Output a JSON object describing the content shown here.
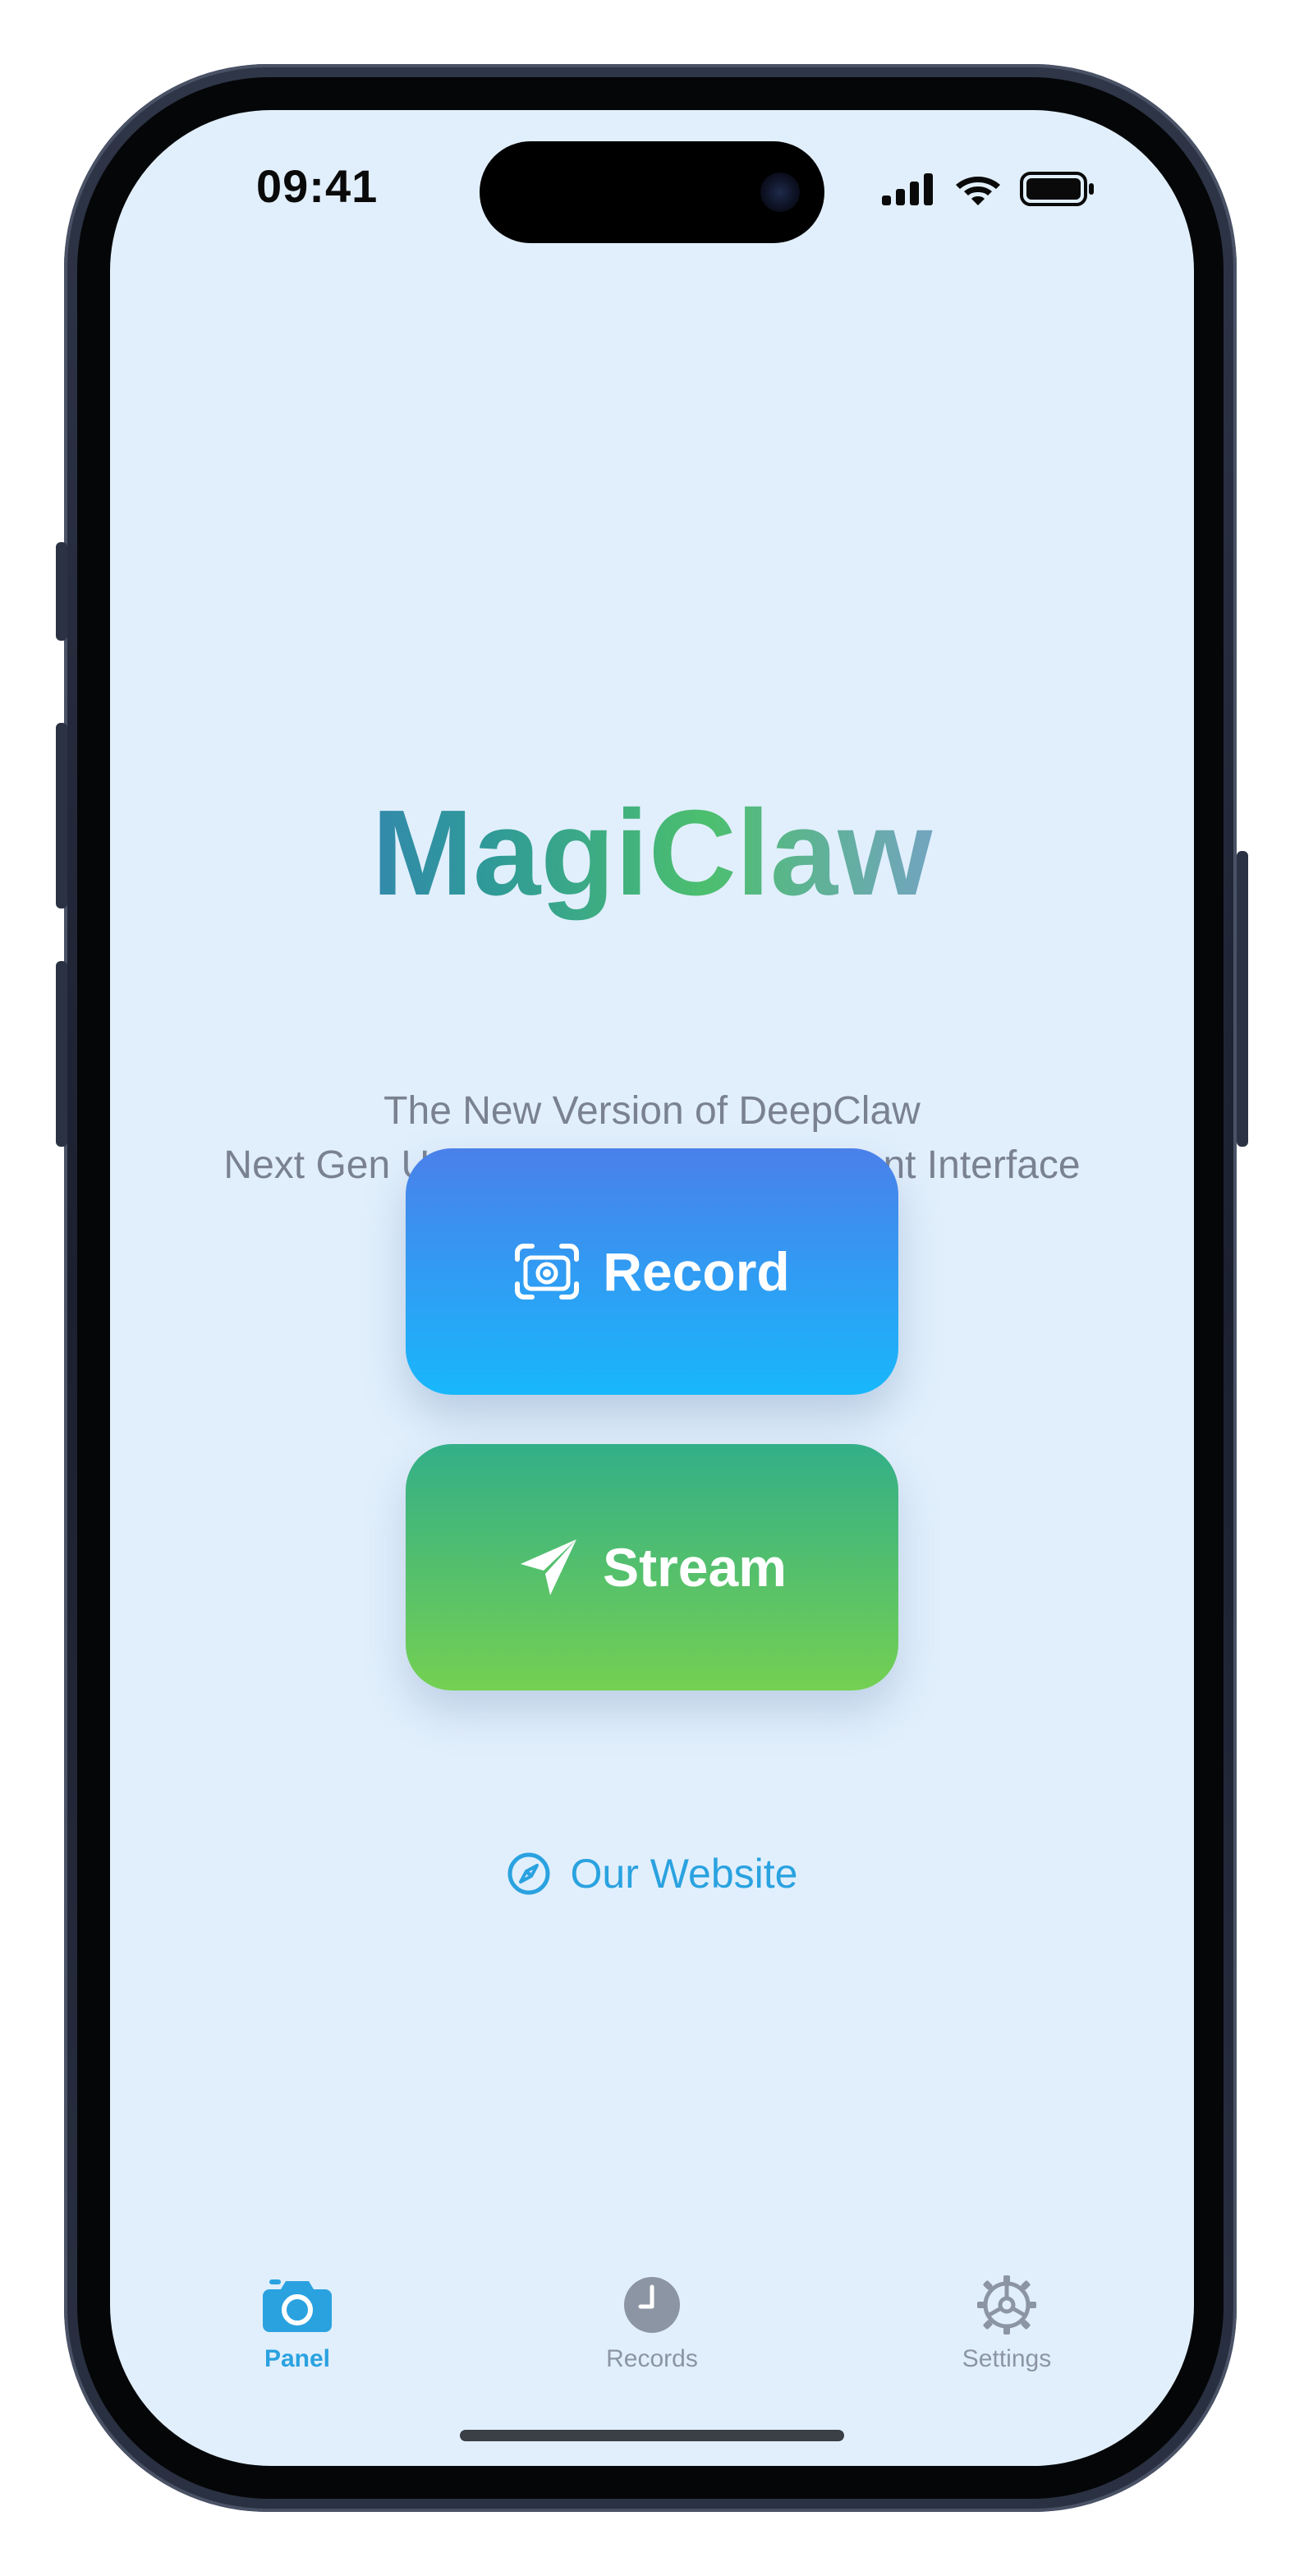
{
  "status_bar": {
    "time": "09:41",
    "icons": [
      "cellular-signal-icon",
      "wifi-icon",
      "battery-icon"
    ]
  },
  "app": {
    "title": "MagiClaw",
    "title_gradient": [
      "#3a66d6",
      "#2f9a98",
      "#4cbf6e",
      "#7a9fd0",
      "#8a8fe0"
    ],
    "subtitle_line_1": "The New Version of DeepClaw",
    "subtitle_line_2": "Next Gen Universal Action Embodiment Interface"
  },
  "actions": {
    "record": {
      "label": "Record",
      "icon": "record-camera-icon",
      "colors": [
        "#4a80ea",
        "#18b7fc"
      ]
    },
    "stream": {
      "label": "Stream",
      "icon": "paper-plane-icon",
      "colors": [
        "#33af88",
        "#74d052"
      ]
    },
    "website": {
      "label": "Our Website",
      "icon": "compass-icon",
      "color": "#2aa2e0"
    }
  },
  "tab_bar": {
    "active_color": "#2aa2e0",
    "inactive_color": "#8c95a3",
    "tabs": [
      {
        "label": "Panel",
        "icon": "camera-icon",
        "active": true
      },
      {
        "label": "Records",
        "icon": "clock-icon",
        "active": false
      },
      {
        "label": "Settings",
        "icon": "gear-icon",
        "active": false
      }
    ]
  },
  "theme": {
    "screen_background": "#e1effc",
    "subtitle_color": "#7a8290"
  }
}
